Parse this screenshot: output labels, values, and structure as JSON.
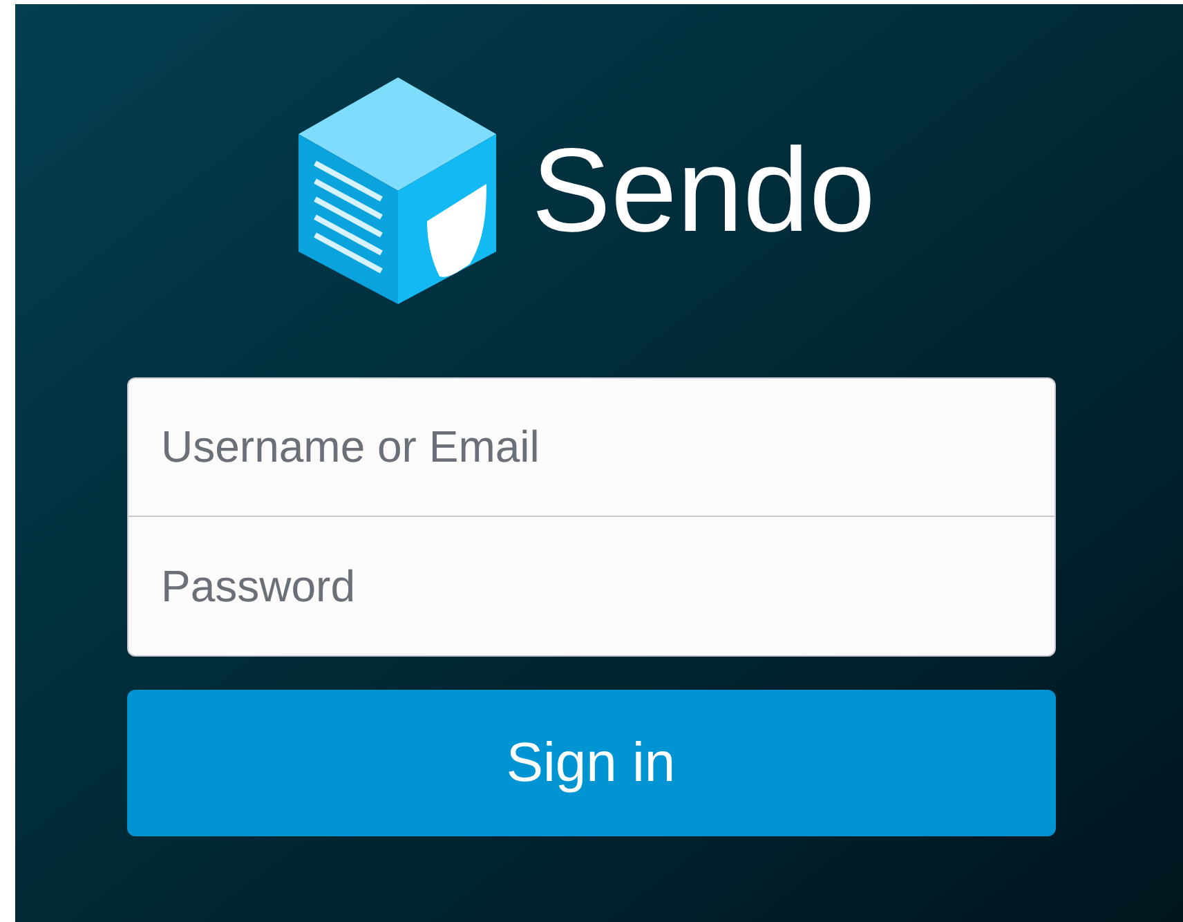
{
  "brand": {
    "name": "Sendo"
  },
  "form": {
    "fields": [
      {
        "placeholder": "Username or Email"
      },
      {
        "placeholder": "Password"
      }
    ],
    "submit": "Sign in"
  }
}
